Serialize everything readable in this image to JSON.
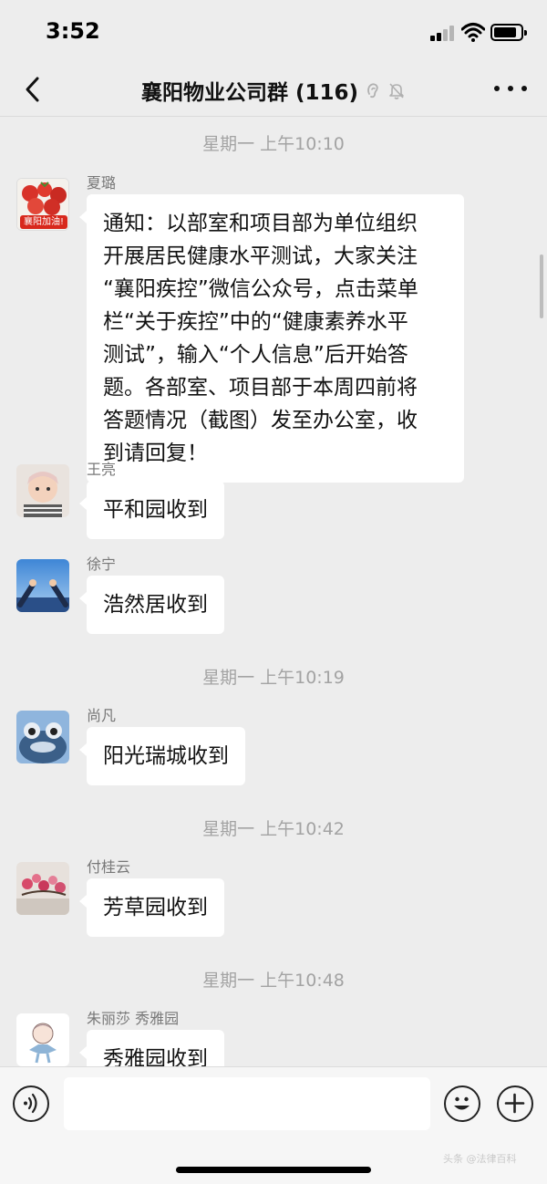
{
  "status_bar": {
    "time": "3:52"
  },
  "nav": {
    "title": "襄阳物业公司群 (116)"
  },
  "messages": [
    {
      "type": "time",
      "text": "星期一 上午10:10"
    },
    {
      "sender": "夏璐",
      "avatar_text": "襄阳加油!",
      "lines": [
        "通知：以部室和项目部为单位组织",
        "开展居民健康水平测试，大家关注",
        "“襄阳疾控”微信公众号，点击菜单",
        "栏“关于疾控”中的“健康素养水平",
        "测试”，输入“个人信息”后开始答",
        "题。各部室、项目部于本周四前将",
        "答题情况（截图）发至办公室，收",
        "到请回复！"
      ]
    },
    {
      "sender": "王亮",
      "text": "平和园收到"
    },
    {
      "sender": "徐宁",
      "text": "浩然居收到"
    },
    {
      "type": "time",
      "text": "星期一 上午10:19"
    },
    {
      "sender": "尚凡",
      "text": "阳光瑞城收到"
    },
    {
      "type": "time",
      "text": "星期一 上午10:42"
    },
    {
      "sender": "付桂云",
      "text": "芳草园收到"
    },
    {
      "type": "time",
      "text": "星期一 上午10:48"
    },
    {
      "sender": "朱丽莎 秀雅园",
      "text": "秀雅园收到"
    }
  ],
  "input": {
    "value": ""
  },
  "icons": {
    "back": "chevron-left-icon",
    "ear": "earpiece-icon",
    "mute": "bell-off-icon",
    "more": "more-icon",
    "voice": "voice-icon",
    "emoji": "emoji-icon",
    "plus": "plus-icon"
  },
  "colors": {
    "bubble": "#ffffff",
    "background": "#ededed",
    "avatar_badge": "#d8281c"
  },
  "watermark": "头条 @法律百科"
}
